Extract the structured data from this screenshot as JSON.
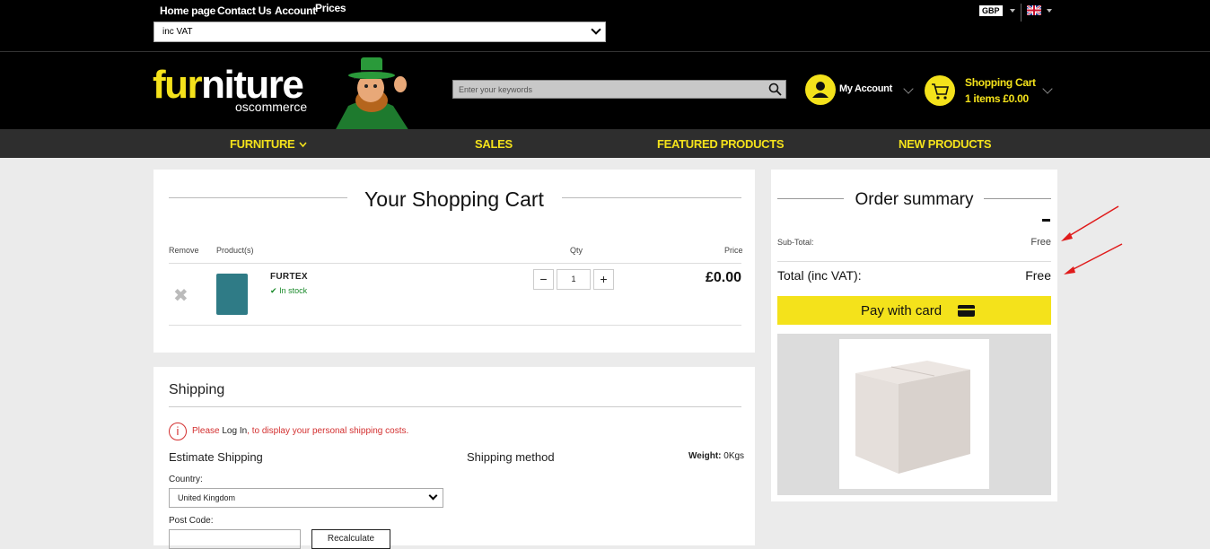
{
  "topbar": {
    "links": [
      "Home page",
      "Contact Us",
      "Account"
    ],
    "prices_label": "Prices",
    "vat_select_value": "inc VAT",
    "currency": "GBP",
    "language_flag": "uk-flag-icon"
  },
  "header": {
    "logo_main_1": "fu",
    "logo_main_2": "r",
    "logo_main_3": "niture",
    "logo_sub": "oscommerce",
    "search_placeholder": "Enter your keywords",
    "my_account": "My Account",
    "cart_title": "Shopping Cart",
    "cart_sub": "1 items £0.00"
  },
  "nav": {
    "items": [
      "FURNITURE",
      "SALES",
      "FEATURED PRODUCTS",
      "NEW PRODUCTS"
    ]
  },
  "cart": {
    "title": "Your Shopping Cart",
    "col_remove": "Remove",
    "col_products": "Product(s)",
    "col_qty": "Qty",
    "col_price": "Price",
    "item": {
      "name": "FURTEX",
      "stock": "In stock",
      "qty": "1",
      "minus": "−",
      "plus": "+",
      "price": "£0.00"
    }
  },
  "shipping": {
    "title": "Shipping",
    "msg_please": "Please",
    "msg_login": "Log In",
    "msg_rest": ", to display your personal shipping costs.",
    "estimate": "Estimate Shipping",
    "method": "Shipping method",
    "weight_label": "Weight:",
    "weight_value": "0Kgs",
    "country_label": "Country:",
    "country_value": "United Kingdom",
    "postcode_label": "Post Code:",
    "recalc": "Recalculate"
  },
  "summary": {
    "title": "Order summary",
    "subtotal_label": "Sub-Total:",
    "subtotal_value": "Free",
    "total_label": "Total (inc VAT):",
    "total_value": "Free",
    "pay_label": "Pay with card"
  },
  "colors": {
    "accent_yellow": "#f4e21b",
    "header_black": "#000000",
    "nav_gray": "#2e2e2e",
    "stock_green": "#1a8a2a",
    "alert_red": "#d32f2f"
  }
}
